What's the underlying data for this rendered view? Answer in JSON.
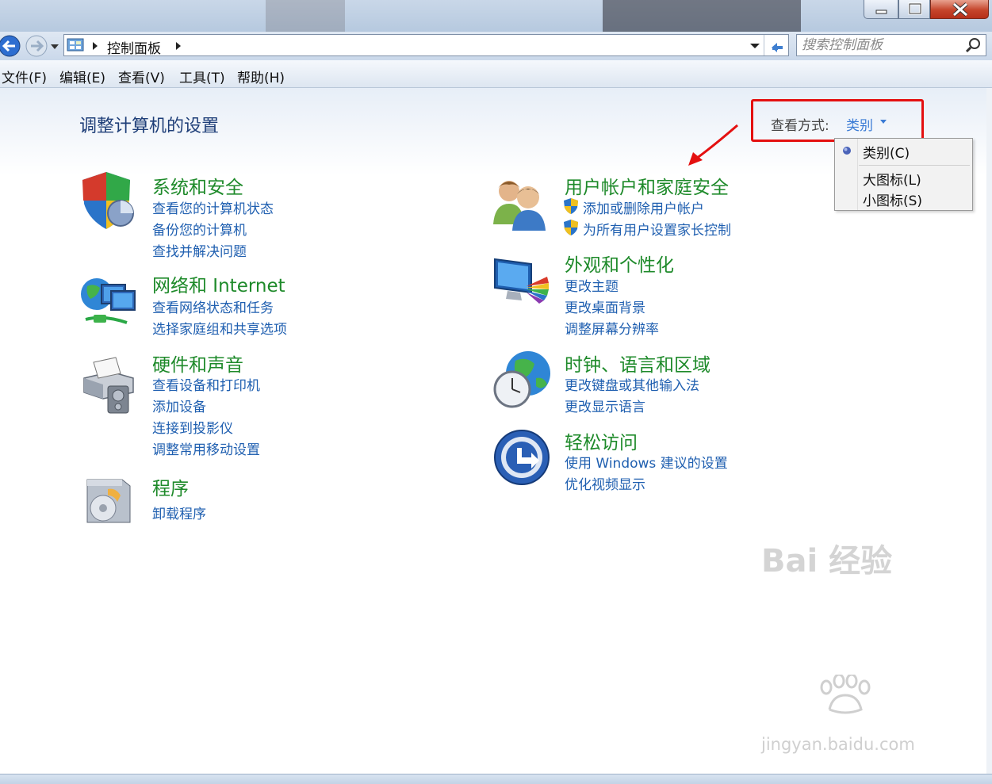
{
  "address": {
    "crumbs": [
      "控制面板"
    ],
    "search_placeholder": "搜索控制面板"
  },
  "menu": [
    "文件(F)",
    "编辑(E)",
    "查看(V)",
    "工具(T)",
    "帮助(H)"
  ],
  "page_title": "调整计算机的设置",
  "view_by": {
    "label": "查看方式:",
    "value": "类别",
    "options": [
      "类别(C)",
      "大图标(L)",
      "小图标(S)"
    ],
    "selected": "类别(C)"
  },
  "categories": {
    "system_security": {
      "title": "系统和安全",
      "links": [
        "查看您的计算机状态",
        "备份您的计算机",
        "查找并解决问题"
      ]
    },
    "network": {
      "title": "网络和 Internet",
      "links": [
        "查看网络状态和任务",
        "选择家庭组和共享选项"
      ]
    },
    "hardware": {
      "title": "硬件和声音",
      "links": [
        "查看设备和打印机",
        "添加设备",
        "连接到投影仪",
        "调整常用移动设置"
      ]
    },
    "programs": {
      "title": "程序",
      "links": [
        "卸载程序"
      ]
    },
    "user_accounts": {
      "title": "用户帐户和家庭安全",
      "links": [
        "添加或删除用户帐户",
        "为所有用户设置家长控制"
      ]
    },
    "appearance": {
      "title": "外观和个性化",
      "links": [
        "更改主题",
        "更改桌面背景",
        "调整屏幕分辨率"
      ]
    },
    "clock": {
      "title": "时钟、语言和区域",
      "links": [
        "更改键盘或其他输入法",
        "更改显示语言"
      ]
    },
    "ease": {
      "title": "轻松访问",
      "links": [
        "使用 Windows 建议的设置",
        "优化视频显示"
      ]
    }
  },
  "watermark": {
    "brand": "Bai 经验",
    "url": "jingyan.baidu.com"
  },
  "colors": {
    "category_title": "#1e8a2a",
    "link": "#1f5fb0",
    "highlight_box": "#e41010",
    "page_title": "#1e3e78"
  }
}
